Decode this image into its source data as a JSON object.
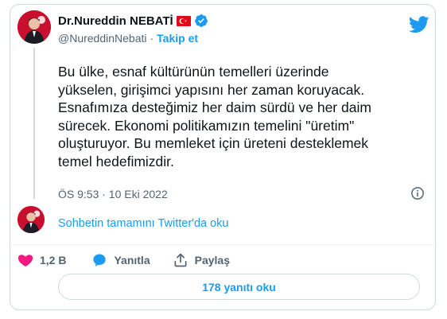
{
  "author": {
    "name": "Dr.Nureddin NEBATİ",
    "handle": "@NureddinNebati",
    "separator": "·",
    "follow_label": "Takip et"
  },
  "tweet": {
    "lines": [
      "Bu ülke, esnaf kültürünün temelleri üzerinde",
      "yükselen, girişimci yapısını her zaman koruyacak.",
      "Esnafımıza desteğimiz her daim sürdü ve her daim",
      "sürecek. Ekonomi politikamızın temelini \"üretim\"",
      "oluşturuyor. Bu memleket için üreteni desteklemek",
      "temel hedefimizdir."
    ],
    "timestamp": "ÖS 9:53 · 10 Eki 2022"
  },
  "conversation_link": "Sohbetin tamamını Twitter'da oku",
  "actions": {
    "like_count": "1,2 B",
    "reply_label": "Yanıtla",
    "share_label": "Paylaş"
  },
  "replies_button": "178 yanıtı oku",
  "colors": {
    "accent": "#1d9bf0",
    "like": "#f91880",
    "text": "#0f1419",
    "muted": "#536471"
  }
}
